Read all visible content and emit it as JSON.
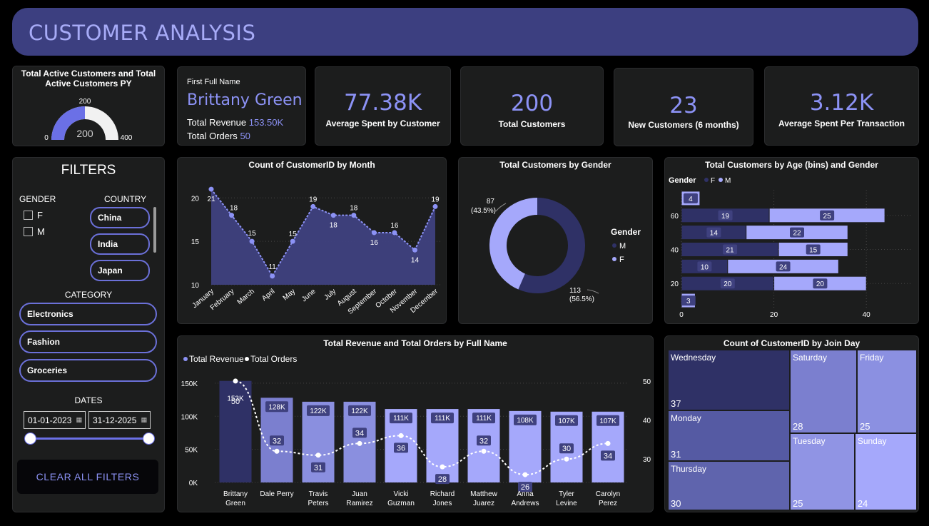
{
  "header": {
    "title": "CUSTOMER ANALYSIS"
  },
  "gauge": {
    "title": "Total Active Customers and Total Active Customers PY",
    "value": 200,
    "value_label": "200",
    "min_label": "0",
    "max_label": "400",
    "target_label": "200",
    "max": 400,
    "fill_color": "#6b70e6",
    "track_color": "#f1f1f1"
  },
  "first_name": {
    "caption": "First Full Name",
    "name": "Brittany Green",
    "revenue_label": "Total Revenue",
    "revenue_value": "153.50K",
    "orders_label": "Total Orders",
    "orders_value": "50"
  },
  "kpis": [
    {
      "value": "77.38K",
      "label": "Average Spent by Customer"
    },
    {
      "value": "200",
      "label": "Total Customers"
    },
    {
      "value": "23",
      "label": "New Customers (6 months)"
    },
    {
      "value": "3.12K",
      "label": "Average Spent Per Transaction"
    }
  ],
  "filters": {
    "title": "FILTERS",
    "gender_label": "GENDER",
    "gender_options": [
      "F",
      "M"
    ],
    "country_label": "COUNTRY",
    "country_options": [
      "China",
      "India",
      "Japan"
    ],
    "category_label": "CATEGORY",
    "category_options": [
      "Electronics",
      "Fashion",
      "Groceries"
    ],
    "dates_label": "DATES",
    "date_from": "01-01-2023",
    "date_to": "31-12-2025",
    "clear_label": "CLEAR ALL FILTERS"
  },
  "charts": {
    "by_month_title": "Count of CustomerID by Month",
    "gender_title": "Total Customers by Gender",
    "age_title": "Total Customers by Age (bins) and Gender",
    "revenue_title": "Total Revenue and Total Orders by Full Name",
    "join_day_title": "Count of CustomerID by Join Day"
  },
  "chart_data": [
    {
      "type": "area",
      "title": "Count of CustomerID by Month",
      "categories": [
        "January",
        "February",
        "March",
        "April",
        "May",
        "June",
        "July",
        "August",
        "September",
        "October",
        "November",
        "December"
      ],
      "values": [
        21,
        18,
        15,
        11,
        15,
        19,
        18,
        18,
        16,
        16,
        14,
        19
      ],
      "yticks": [
        10,
        15,
        20
      ],
      "ylim": [
        10,
        21.5
      ],
      "color": "#3f417f",
      "line_color": "#8c92f5"
    },
    {
      "type": "pie",
      "title": "Total Customers by Gender",
      "legend_title": "Gender",
      "legend_position": "right",
      "slices": [
        {
          "name": "M",
          "value": 113,
          "label": "113",
          "pct": "(56.5%)",
          "color": "#2f3166"
        },
        {
          "name": "F",
          "value": 87,
          "label": "87",
          "pct": "(43.5%)",
          "color": "#a5a8fb"
        }
      ]
    },
    {
      "type": "bar",
      "title": "Total Customers by Age (bins) and Gender",
      "legend_title": "Gender",
      "series": [
        {
          "name": "F",
          "color": "#2f3166"
        },
        {
          "name": "M",
          "color": "#a5a8fb"
        }
      ],
      "rows": [
        {
          "age_bin": 70,
          "F": 0,
          "M": 4
        },
        {
          "age_bin": 60,
          "F": 19,
          "M": 25
        },
        {
          "age_bin": 50,
          "F": 14,
          "M": 22
        },
        {
          "age_bin": 40,
          "F": 21,
          "M": 15
        },
        {
          "age_bin": 30,
          "F": 10,
          "M": 24
        },
        {
          "age_bin": 20,
          "F": 20,
          "M": 20
        },
        {
          "age_bin": 10,
          "F": 0,
          "M": 3
        }
      ],
      "yticks": [
        20,
        40,
        60
      ],
      "xticks": [
        0,
        20,
        40
      ],
      "xlim": [
        0,
        50
      ],
      "ylim": [
        5,
        75
      ]
    },
    {
      "type": "bar",
      "title": "Total Revenue and Total Orders by Full Name",
      "legend": [
        "Total Revenue",
        "Total Orders"
      ],
      "categories": [
        "Brittany Green",
        "Dale Perry",
        "Travis Peters",
        "Juan Ramirez",
        "Vicki Guzman",
        "Richard Jones",
        "Matthew Juarez",
        "Anna Andrews",
        "Tyler Levine",
        "Carolyn Perez"
      ],
      "series": [
        {
          "name": "Total Revenue",
          "values": [
            153.5,
            128,
            122,
            122,
            111,
            111,
            111,
            108,
            107,
            107
          ],
          "labels": [
            "153K",
            "128K",
            "122K",
            "122K",
            "111K",
            "111K",
            "111K",
            "108K",
            "107K",
            "107K"
          ]
        },
        {
          "name": "Total Orders",
          "values": [
            50,
            32,
            31,
            34,
            36,
            28,
            32,
            26,
            30,
            34
          ]
        }
      ],
      "y_left_ticks": [
        "0K",
        "50K",
        "100K",
        "150K"
      ],
      "y_left_lim": [
        0,
        165
      ],
      "y_right_ticks": [
        30,
        40,
        50
      ],
      "y_right_lim": [
        24,
        52
      ],
      "colors": [
        "#2f3166",
        "#7b7fcf",
        "#8a8fdf",
        "#9a9eec",
        "#a5a8fb"
      ],
      "line_color": "#ffffff"
    },
    {
      "type": "heatmap",
      "title": "Count of CustomerID by Join Day",
      "cells": [
        {
          "label": "Wednesday",
          "value": 37,
          "color": "#2f3166"
        },
        {
          "label": "Monday",
          "value": 31,
          "color": "#555aa3"
        },
        {
          "label": "Thursday",
          "value": 30,
          "color": "#5f64ad"
        },
        {
          "label": "Saturday",
          "value": 28,
          "color": "#7b7fcf"
        },
        {
          "label": "Friday",
          "value": 25,
          "color": "#8b90e1"
        },
        {
          "label": "Tuesday",
          "value": 25,
          "color": "#9094e4"
        },
        {
          "label": "Sunday",
          "value": 24,
          "color": "#a5a8fb"
        }
      ]
    }
  ]
}
